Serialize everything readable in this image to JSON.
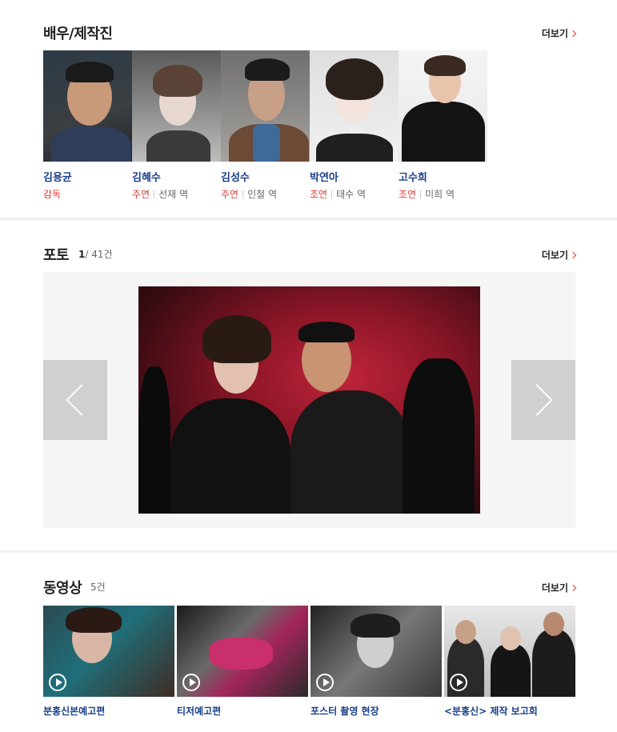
{
  "cast_section": {
    "title": "배우/제작진",
    "more_label": "더보기",
    "members": [
      {
        "name": "김용균",
        "role_type": "감독",
        "role_name": ""
      },
      {
        "name": "김혜수",
        "role_type": "주연",
        "role_name": "선재 역"
      },
      {
        "name": "김성수",
        "role_type": "주연",
        "role_name": "인철 역"
      },
      {
        "name": "박연아",
        "role_type": "조연",
        "role_name": "태수 역"
      },
      {
        "name": "고수희",
        "role_type": "조연",
        "role_name": "미희 역"
      }
    ]
  },
  "photo_section": {
    "title": "포토",
    "current": "1",
    "total": "/ 41건",
    "more_label": "더보기"
  },
  "video_section": {
    "title": "동영상",
    "count": "5건",
    "more_label": "더보기",
    "videos": [
      {
        "title": "분홍신본예고편"
      },
      {
        "title": "티저예고편"
      },
      {
        "title": "포스터 촬영 현장"
      },
      {
        "title": "<분홍신> 제작 보고회"
      }
    ]
  },
  "colors": {
    "accent_red": "#e03a3a",
    "link_blue": "#1a3f8a"
  }
}
